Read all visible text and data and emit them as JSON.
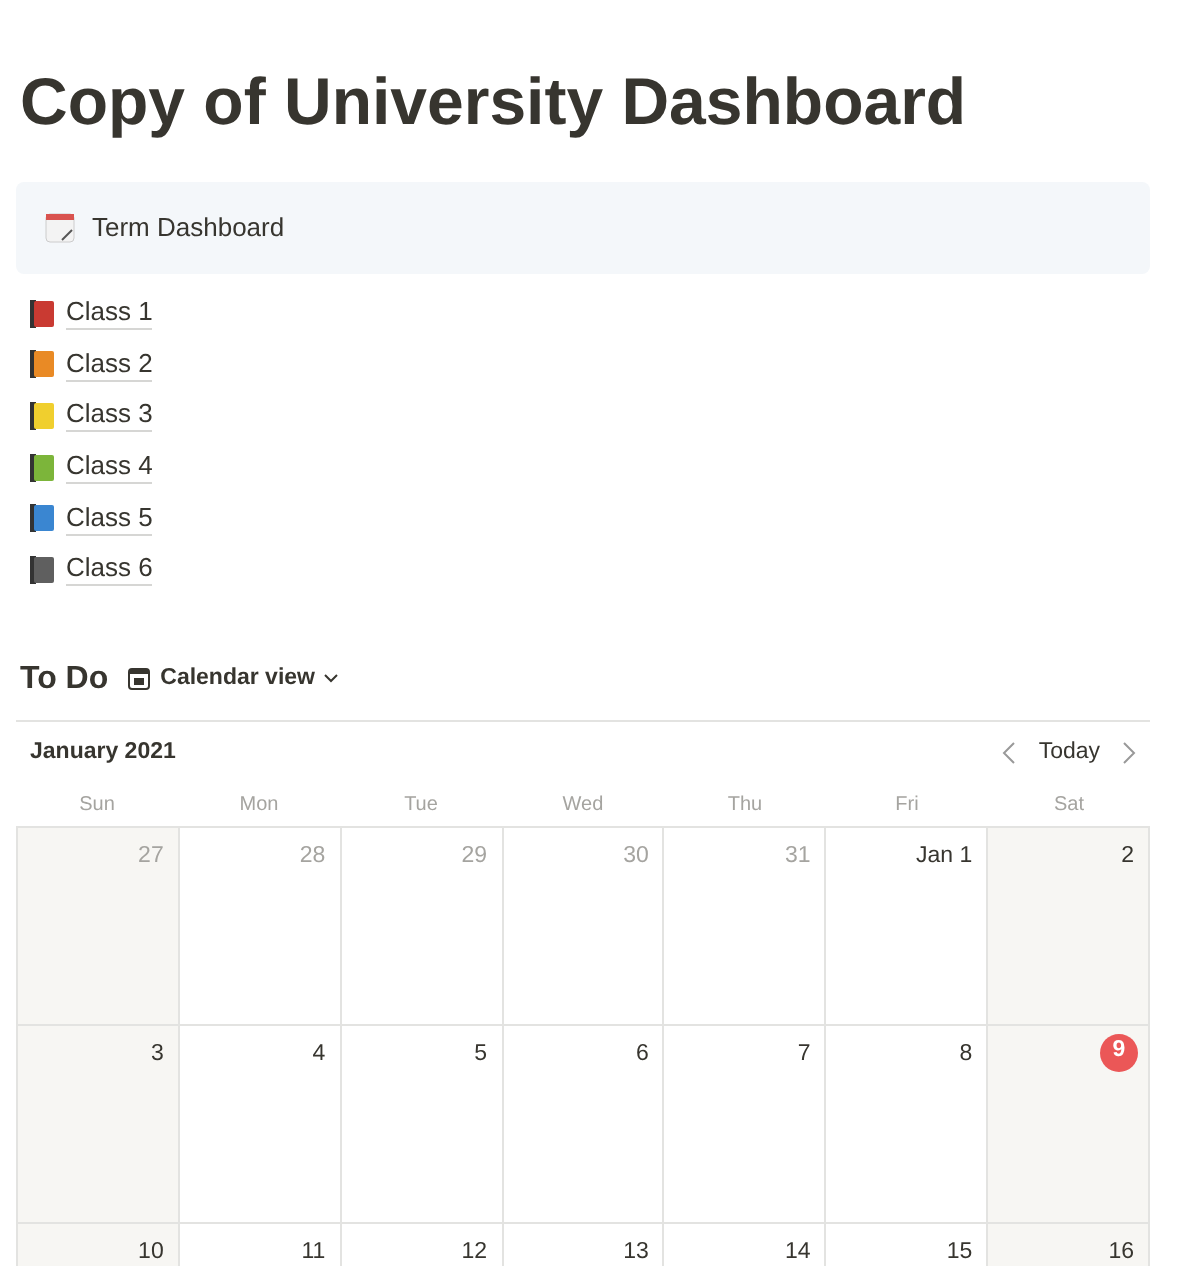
{
  "title": "Copy of University Dashboard",
  "callout": {
    "text": "Term Dashboard"
  },
  "classes": [
    {
      "label": "Class 1",
      "color": "#c93a32"
    },
    {
      "label": "Class 2",
      "color": "#e98a25"
    },
    {
      "label": "Class 3",
      "color": "#f0cf2e"
    },
    {
      "label": "Class 4",
      "color": "#7cb53a"
    },
    {
      "label": "Class 5",
      "color": "#3a86d1"
    },
    {
      "label": "Class 6",
      "color": "#5f5f5f"
    }
  ],
  "todo": {
    "title": "To Do",
    "view": "Calendar view"
  },
  "calendar": {
    "month": "January 2021",
    "today_button": "Today",
    "weekdays": [
      "Sun",
      "Mon",
      "Tue",
      "Wed",
      "Thu",
      "Fri",
      "Sat"
    ],
    "weeks": [
      [
        {
          "day": "27",
          "muted": true,
          "shaded": true,
          "today": false
        },
        {
          "day": "28",
          "muted": true,
          "shaded": false,
          "today": false
        },
        {
          "day": "29",
          "muted": true,
          "shaded": false,
          "today": false
        },
        {
          "day": "30",
          "muted": true,
          "shaded": false,
          "today": false
        },
        {
          "day": "31",
          "muted": true,
          "shaded": false,
          "today": false
        },
        {
          "day": "Jan 1",
          "muted": false,
          "shaded": false,
          "today": false
        },
        {
          "day": "2",
          "muted": false,
          "shaded": true,
          "today": false
        }
      ],
      [
        {
          "day": "3",
          "muted": false,
          "shaded": true,
          "today": false
        },
        {
          "day": "4",
          "muted": false,
          "shaded": false,
          "today": false
        },
        {
          "day": "5",
          "muted": false,
          "shaded": false,
          "today": false
        },
        {
          "day": "6",
          "muted": false,
          "shaded": false,
          "today": false
        },
        {
          "day": "7",
          "muted": false,
          "shaded": false,
          "today": false
        },
        {
          "day": "8",
          "muted": false,
          "shaded": false,
          "today": false
        },
        {
          "day": "9",
          "muted": false,
          "shaded": true,
          "today": true
        }
      ],
      [
        {
          "day": "10",
          "muted": false,
          "shaded": true,
          "today": false
        },
        {
          "day": "11",
          "muted": false,
          "shaded": false,
          "today": false
        },
        {
          "day": "12",
          "muted": false,
          "shaded": false,
          "today": false
        },
        {
          "day": "13",
          "muted": false,
          "shaded": false,
          "today": false
        },
        {
          "day": "14",
          "muted": false,
          "shaded": false,
          "today": false
        },
        {
          "day": "15",
          "muted": false,
          "shaded": false,
          "today": false
        },
        {
          "day": "16",
          "muted": false,
          "shaded": true,
          "today": false
        }
      ]
    ]
  }
}
